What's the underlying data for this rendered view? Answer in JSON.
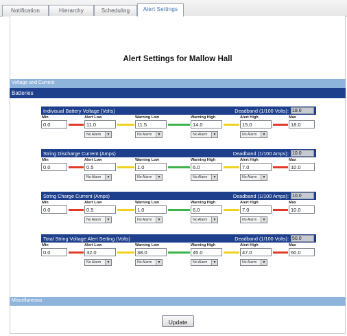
{
  "tabs": [
    {
      "label": "Notification",
      "active": false
    },
    {
      "label": "Hierarchy",
      "active": false
    },
    {
      "label": "Scheduling",
      "active": false
    },
    {
      "label": "Alert Settings",
      "active": true
    }
  ],
  "page_title": "Alert Settings for Mallow Hall",
  "sections": {
    "voltage": "Voltage and Current",
    "batteries": "Batteries",
    "misc": "Miscellaneous"
  },
  "column_labels": {
    "min": "Min",
    "alert_low": "Alert Low",
    "warning_low": "Warning Low",
    "warning_high": "Warning High",
    "alert_high": "Alert High",
    "max": "Max"
  },
  "select_default": "No Alarm",
  "boxes": [
    {
      "title": "Indivisual Battery Voltage (Volts)",
      "deadband_label": "Deadband (1/100 Volts):",
      "deadband": "18.0",
      "min": "0.0",
      "alert_low": "11.0",
      "warning_low": "11.5",
      "warning_high": "14.0",
      "alert_high": "15.0",
      "max": "18.0"
    },
    {
      "title": "String Discharge Current (Amps)",
      "deadband_label": "Deadband (1/100 Amps):",
      "deadband": "10.0",
      "min": "0.0",
      "alert_low": "0.5",
      "warning_low": "1.0",
      "warning_high": "6.0",
      "alert_high": "7.0",
      "max": "10.0"
    },
    {
      "title": "String Charge Current (Amps)",
      "deadband_label": "Deadband (1/100 Amps):",
      "deadband": "10.0",
      "min": "0.0",
      "alert_low": "0.5",
      "warning_low": "1.0",
      "warning_high": "6.0",
      "alert_high": "7.0",
      "max": "10.0"
    },
    {
      "title": "Total String Voltage Alert Setting (Volts)",
      "deadband_label": "Deadband (1/100 Volts):",
      "deadband": "50.0",
      "min": "0.0",
      "alert_low": "32.0",
      "warning_low": "38.0",
      "warning_high": "45.0",
      "alert_high": "47.0",
      "max": "60.0"
    }
  ],
  "update_label": "Update",
  "colors": {
    "alert_line": "#e03a2a",
    "warning_line": "#f1d01e",
    "normal_line": "#3bb54a",
    "header_navy": "#1d3f8c",
    "section_light_blue": "#8fb4dc"
  }
}
